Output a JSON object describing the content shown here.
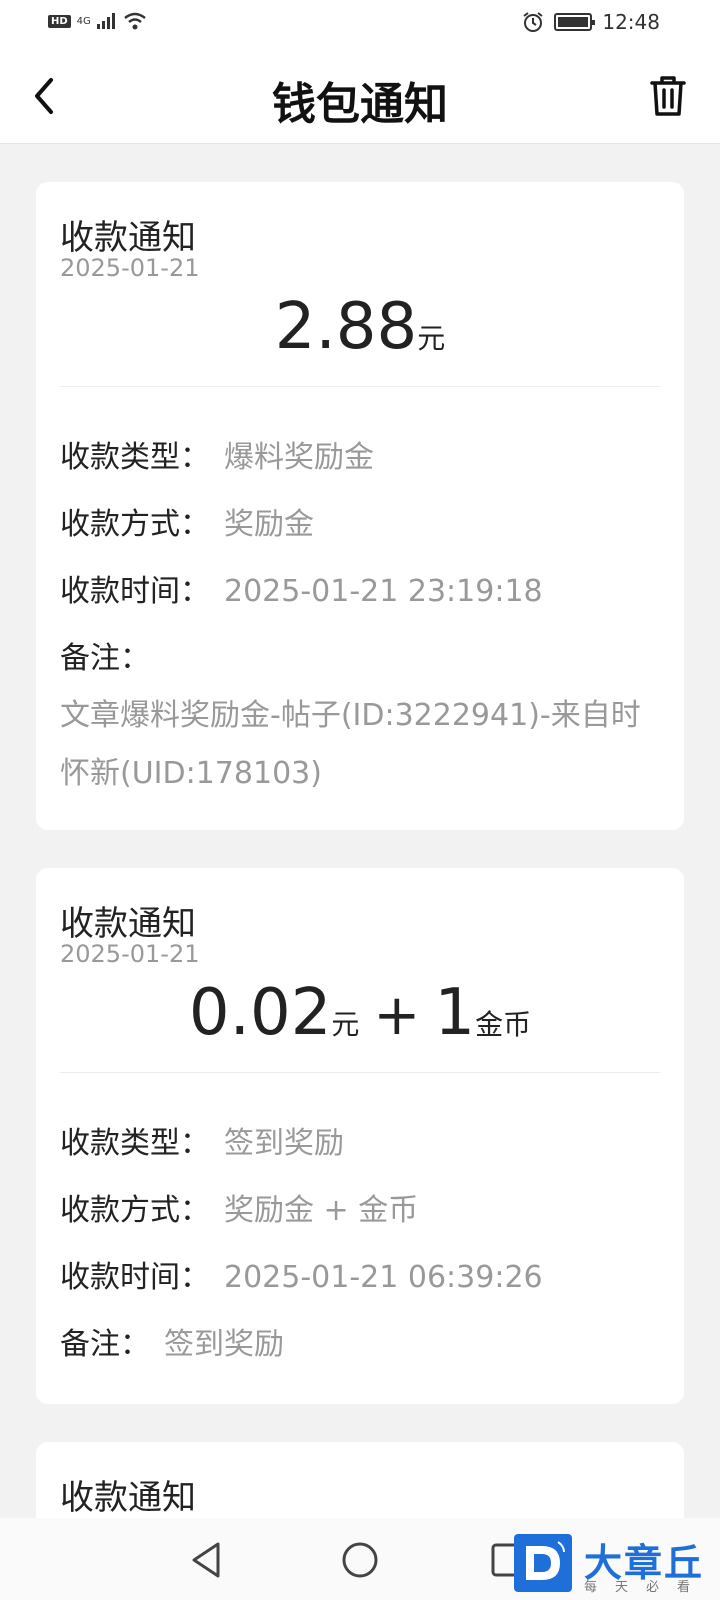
{
  "status_bar": {
    "hd": "HD",
    "network": "4G",
    "time": "12:48",
    "icons": [
      "signal-icon",
      "wifi-icon",
      "alarm-icon",
      "battery-icon"
    ]
  },
  "header": {
    "title": "钱包通知",
    "back_icon": "chevron-left-icon",
    "trash_icon": "trash-icon"
  },
  "notifications": [
    {
      "title": "收款通知",
      "date": "2025-01-21",
      "amount": {
        "yuan": "2.88",
        "yuan_unit": "元"
      },
      "type_label": "收款类型：",
      "type_value": "爆料奖励金",
      "method_label": "收款方式：",
      "method_value": "奖励金",
      "time_label": "收款时间：",
      "time_value": "2025-01-21 23:19:18",
      "note_label": "备注：",
      "note_value": "文章爆料奖励金-帖子(ID:3222941)-来自时怀新(UID:178103)"
    },
    {
      "title": "收款通知",
      "date": "2025-01-21",
      "amount": {
        "yuan": "0.02",
        "yuan_unit": "元",
        "plus": "+",
        "coins": "1",
        "coin_unit": "金币"
      },
      "type_label": "收款类型：",
      "type_value": "签到奖励",
      "method_label": "收款方式：",
      "method_value": "奖励金 + 金币",
      "time_label": "收款时间：",
      "time_value": "2025-01-21 06:39:26",
      "note_label": "备注：",
      "note_value": "签到奖励"
    },
    {
      "title": "收款通知"
    }
  ],
  "watermark": {
    "brand": "大章丘",
    "sub": "每天必看"
  },
  "colors": {
    "background": "#f2f2f2",
    "card": "#ffffff",
    "secondary_text": "#999999",
    "watermark_blue": "#1e6fd9"
  }
}
